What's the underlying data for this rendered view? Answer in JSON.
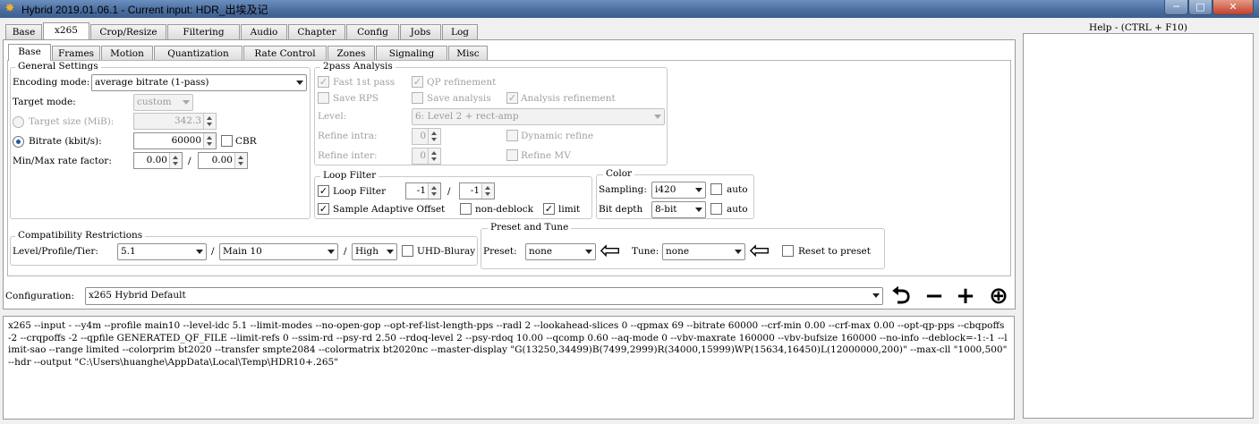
{
  "window": {
    "title": "Hybrid 2019.01.06.1 - Current input: HDR_出埃及记",
    "minimize": "─",
    "maximize": "□",
    "close": "✕"
  },
  "main_tabs": [
    {
      "label": "Base"
    },
    {
      "label": "x265"
    },
    {
      "label": "Crop/Resize"
    },
    {
      "label": "Filtering"
    },
    {
      "label": "Audio"
    },
    {
      "label": "Chapter"
    },
    {
      "label": "Config"
    },
    {
      "label": "Jobs"
    },
    {
      "label": "Log"
    }
  ],
  "sub_tabs": [
    {
      "label": "Base"
    },
    {
      "label": "Frames"
    },
    {
      "label": "Motion"
    },
    {
      "label": "Quantization"
    },
    {
      "label": "Rate Control"
    },
    {
      "label": "Zones"
    },
    {
      "label": "Signaling"
    },
    {
      "label": "Misc"
    }
  ],
  "general": {
    "title": "General Settings",
    "encoding_mode_label": "Encoding mode:",
    "encoding_mode_value": "average bitrate (1-pass)",
    "target_mode_label": "Target mode:",
    "target_mode_value": "custom",
    "target_size_label": "Target size (MiB):",
    "target_size_value": "342.3",
    "bitrate_label": "Bitrate (kbit/s):",
    "bitrate_value": "60000",
    "cbr_label": "CBR",
    "minmax_label": "Min/Max rate factor:",
    "min_value": "0.00",
    "slash": "/",
    "max_value": "0.00"
  },
  "twopass": {
    "title": "2pass Analysis",
    "fast_1st_pass": "Fast 1st pass",
    "qp_refinement": "QP refinement",
    "save_rps": "Save RPS",
    "save_analysis": "Save analysis",
    "analysis_refinement": "Analysis refinement",
    "level_label": "Level:",
    "level_value": "6: Level 2 + rect-amp",
    "refine_intra_label": "Refine intra:",
    "refine_intra_value": "0",
    "refine_inter_label": "Refine inter:",
    "refine_inter_value": "0",
    "dynamic_refine": "Dynamic refine",
    "refine_mv": "Refine MV"
  },
  "loop_filter": {
    "title": "Loop Filter",
    "loop_filter_label": "Loop Filter",
    "value1": "-1",
    "slash": "/",
    "value2": "-1",
    "sao_label": "Sample Adaptive Offset",
    "non_deblock_label": "non-deblock",
    "limit_label": "limit"
  },
  "color": {
    "title": "Color",
    "sampling_label": "Sampling:",
    "sampling_value": "i420",
    "auto1": "auto",
    "bitdepth_label": "Bit depth",
    "bitdepth_value": "8-bit",
    "auto2": "auto"
  },
  "compat": {
    "title": "Compatibility Restrictions",
    "label": "Level/Profile/Tier:",
    "level_value": "5.1",
    "profile_value": "Main 10",
    "tier_value": "High",
    "slash": "/",
    "uhd_bluray": "UHD-Bluray"
  },
  "preset": {
    "title": "Preset and Tune",
    "preset_label": "Preset:",
    "preset_value": "none",
    "tune_label": "Tune:",
    "tune_value": "none",
    "reset_label": "Reset to preset"
  },
  "config": {
    "label": "Configuration:",
    "value": "x265 Hybrid Default"
  },
  "help": {
    "title": "Help - (CTRL + F10)"
  },
  "command_line": "x265 --input - --y4m --profile main10 --level-idc 5.1 --limit-modes --no-open-gop --opt-ref-list-length-pps --radl 2 --lookahead-slices 0 --qpmax 69 --bitrate 60000 --crf-min 0.00 --crf-max 0.00 --opt-qp-pps --cbqpoffs -2 --crqpoffs -2 --qpfile GENERATED_QF_FILE --limit-refs 0 --ssim-rd --psy-rd 2.50 --rdoq-level 2 --psy-rdoq 10.00 --qcomp 0.60 --aq-mode 0 --vbv-maxrate 160000 --vbv-bufsize 160000 --no-info --deblock=-1:-1 --limit-sao --range limited --colorprim bt2020 --transfer smpte2084 --colormatrix bt2020nc --master-display \"G(13250,34499)B(7499,2999)R(34000,15999)WP(15634,16450)L(12000000,200)\" --max-cll \"1000,500\" --hdr --output \"C:\\Users\\huanghe\\AppData\\Local\\Temp\\HDR10+.265\"",
  "icons": {
    "app": "gear-icon",
    "undo": "undo-icon",
    "remove": "minus-icon",
    "add": "plus-icon",
    "save": "save-config-icon",
    "arrow": "left-arrow-icon"
  }
}
